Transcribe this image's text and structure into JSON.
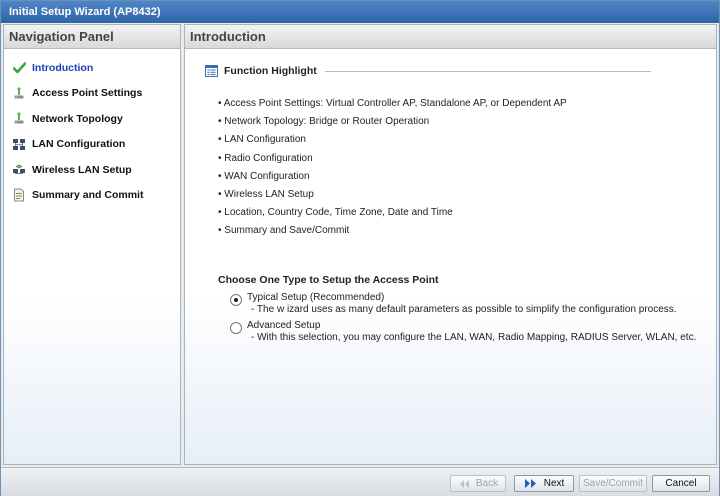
{
  "window": {
    "title": "Initial Setup Wizard (AP8432)"
  },
  "nav": {
    "header": "Navigation Panel",
    "items": [
      {
        "label": "Introduction",
        "icon": "checkmark-icon",
        "active": true
      },
      {
        "label": "Access Point Settings",
        "icon": "access-point-icon"
      },
      {
        "label": "Network Topology",
        "icon": "access-point-icon"
      },
      {
        "label": "LAN Configuration",
        "icon": "network-icon"
      },
      {
        "label": "Wireless LAN Setup",
        "icon": "wireless-network-icon"
      },
      {
        "label": "Summary and Commit",
        "icon": "document-icon"
      }
    ]
  },
  "content": {
    "header": "Introduction",
    "function_highlight": "Function Highlight",
    "features": [
      "• Access Point Settings: Virtual Controller AP, Standalone AP, or Dependent AP",
      "• Network Topology: Bridge or Router Operation",
      "• LAN Configuration",
      "• Radio Configuration",
      "• WAN Configuration",
      "• Wireless LAN Setup",
      "• Location, Country Code, Time Zone, Date and Time",
      "• Summary and Save/Commit"
    ],
    "choose_heading": "Choose One Type to Setup the Access Point",
    "options": [
      {
        "label": "Typical Setup (Recommended)",
        "desc": "- The w izard uses as many default parameters as possible to simplify the configuration process.",
        "checked": true
      },
      {
        "label": "Advanced Setup",
        "desc": "- With this selection, you may configure the LAN, WAN, Radio Mapping, RADIUS Server, WLAN, etc.",
        "checked": false
      }
    ]
  },
  "buttons": {
    "back": "Back",
    "next": "Next",
    "save_commit": "Save/Commit",
    "cancel": "Cancel"
  },
  "colors": {
    "accent": "#2f64a6",
    "active_nav": "#1a3fb0",
    "check": "#3aa83a"
  }
}
